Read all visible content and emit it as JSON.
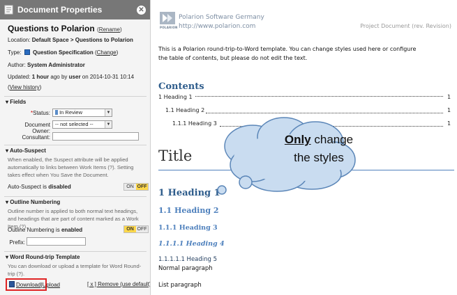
{
  "panel": {
    "header_title": "Document Properties",
    "doc_title": "Questions to Polarion",
    "rename_label": "Rename",
    "location_label": "Location:",
    "location_value": "Default Space > Questions to Polarion",
    "type_label": "Type:",
    "type_value": "Question Specification",
    "type_change": "Change",
    "author_label": "Author:",
    "author_value": "System Administrator",
    "updated_label": "Updated:",
    "updated_ago": "1 hour",
    "updated_by": "ago by",
    "updated_user": "user",
    "updated_on": "on 2014-10-31 10:14",
    "view_history": "View history",
    "fields": {
      "heading": "Fields",
      "status_label": "Status:",
      "status_value": "In Review",
      "owner_label": "Document Owner:",
      "owner_value": "-- not selected --",
      "consultant_label": "Consultant:"
    },
    "auto_suspect": {
      "heading": "Auto-Suspect",
      "description": "When enabled, the Suspect attribute will be applied automatically to links between Work Items (?). Setting takes effect when You Save the Document.",
      "status_prefix": "Auto-Suspect is",
      "status_value": "disabled",
      "on": "ON",
      "off": "OFF"
    },
    "outline": {
      "heading": "Outline Numbering",
      "description": "Outline number is applied to both normal text headings, and headings that are part of content marked as a Work Item (?).",
      "status_prefix": "Outline Numbering is",
      "status_value": "enabled",
      "on": "ON",
      "off": "OFF",
      "prefix_label": "Prefix:"
    },
    "word": {
      "heading": "Word Round-trip Template",
      "description": "You can download or upload a template for Word Round-trip (?).",
      "download": "Download",
      "upload": "Upload",
      "remove": "[ x ] Remove (use default)"
    }
  },
  "document": {
    "company": "Polarion Software Germany",
    "url": "http://www.polarion.com",
    "logo_text": "POLARION",
    "doc_type": "Project Document (rev. Revision)",
    "intro_line1": "This is a Polarion round-trip-to-Word template. You can change styles used here or configure",
    "intro_line2": "the table of contents, but please do not edit the text.",
    "contents_title": "Contents",
    "toc": [
      {
        "text": "1 Heading 1",
        "page": "1"
      },
      {
        "text": "1.1 Heading 2",
        "page": "1"
      },
      {
        "text": "1.1.1 Heading 3",
        "page": "1"
      }
    ],
    "title": "Title",
    "h1": "1 Heading 1",
    "h2": "1.1 Heading 2",
    "h3": "1.1.1 Heading 3",
    "h4": "1.1.1.1 Heading 4",
    "h5": "1.1.1.1.1 Heading 5",
    "normal_para": "Normal paragraph",
    "list_para": "List paragraph",
    "callout_bold": "Only",
    "callout_rest1": " change",
    "callout_line2": "the styles"
  },
  "colors": {
    "header_bg": "#777777",
    "heading_blue": "#2f5d8c",
    "cloud_fill": "#c9dcf0",
    "cloud_stroke": "#5b86b8",
    "highlight": "#e02424"
  }
}
